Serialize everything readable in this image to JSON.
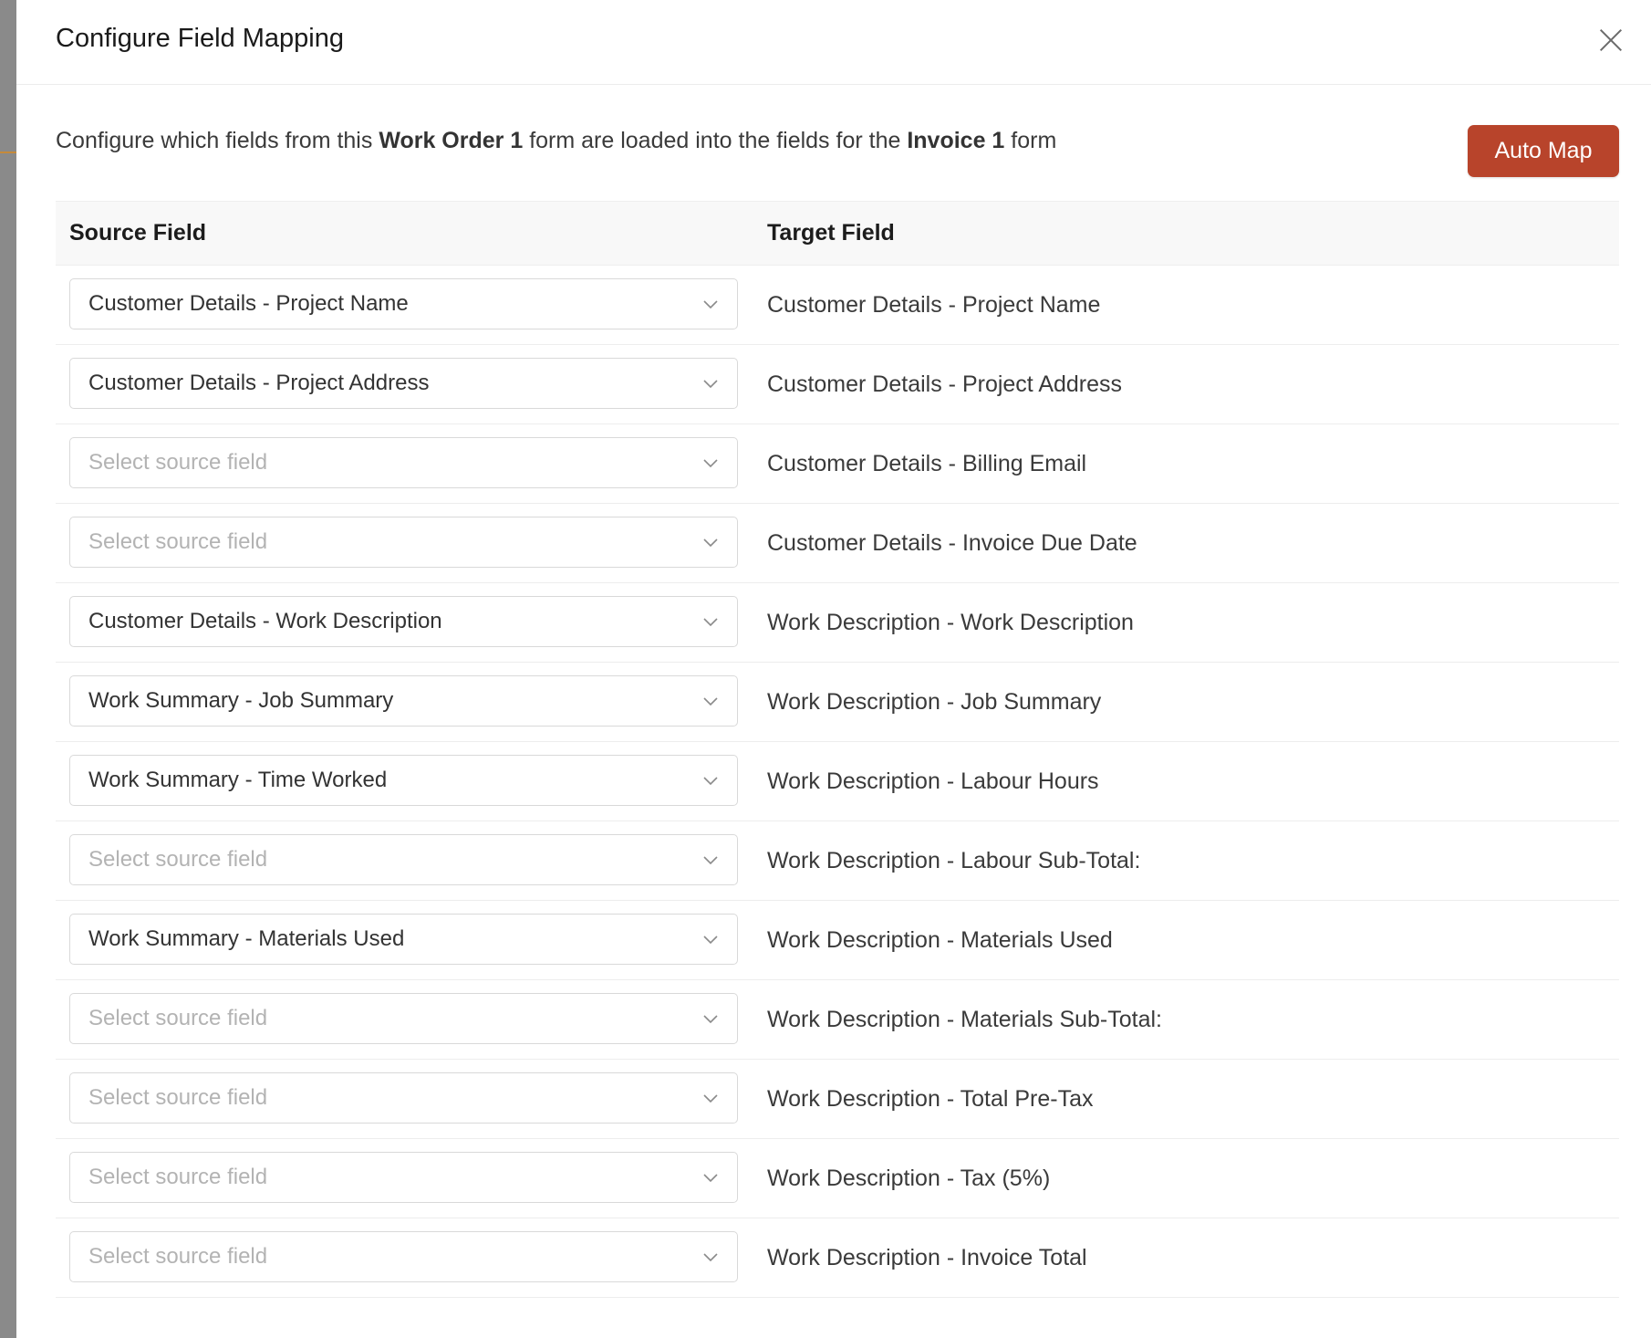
{
  "modal": {
    "title": "Configure Field Mapping",
    "intro": {
      "part1": "Configure which fields from this ",
      "source_form": "Work Order 1",
      "part2": " form are loaded into the fields for the ",
      "target_form": "Invoice 1",
      "part3": " form"
    },
    "auto_map_label": "Auto Map",
    "accent_color": "#b8442b"
  },
  "table": {
    "headers": {
      "source": "Source Field",
      "target": "Target Field"
    },
    "placeholder": "Select source field",
    "rows": [
      {
        "source": "Customer Details - Project Name",
        "target": "Customer Details - Project Name"
      },
      {
        "source": "Customer Details - Project Address",
        "target": "Customer Details - Project Address"
      },
      {
        "source": "",
        "target": "Customer Details - Billing Email"
      },
      {
        "source": "",
        "target": "Customer Details - Invoice Due Date"
      },
      {
        "source": "Customer Details - Work Description",
        "target": "Work Description - Work Description"
      },
      {
        "source": "Work Summary - Job Summary",
        "target": "Work Description - Job Summary"
      },
      {
        "source": "Work Summary - Time Worked",
        "target": "Work Description - Labour Hours"
      },
      {
        "source": "",
        "target": "Work Description - Labour Sub-Total:"
      },
      {
        "source": "Work Summary - Materials Used",
        "target": "Work Description - Materials Used"
      },
      {
        "source": "",
        "target": "Work Description - Materials Sub-Total:"
      },
      {
        "source": "",
        "target": "Work Description - Total Pre-Tax"
      },
      {
        "source": "",
        "target": "Work Description - Tax (5%)"
      },
      {
        "source": "",
        "target": "Work Description - Invoice Total"
      }
    ]
  }
}
